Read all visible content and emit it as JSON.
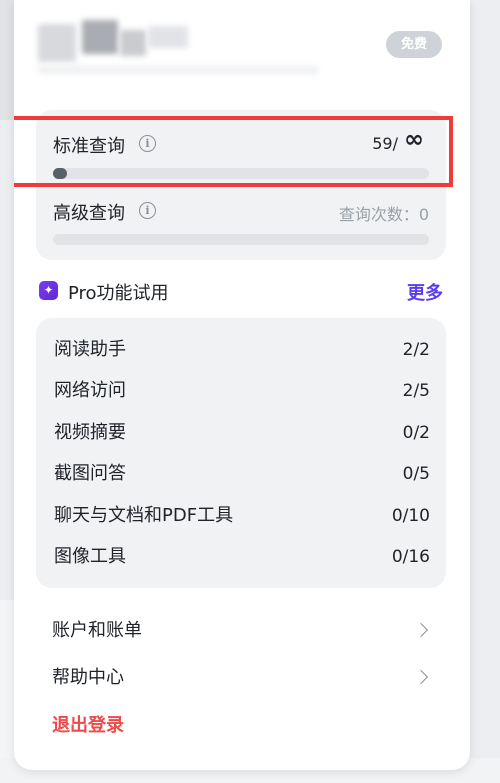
{
  "account": {
    "plan_badge": "免费"
  },
  "queries": {
    "standard": {
      "label": "标准查询",
      "count": "59/",
      "limit_symbol": "∞",
      "progress": 0.03
    },
    "advanced": {
      "label": "高级查询",
      "count_text": "查询次数：0",
      "progress": 0.0
    }
  },
  "pro": {
    "title": "Pro功能试用",
    "more_label": "更多",
    "accent_color": "#5b3bf0",
    "features": [
      {
        "label": "阅读助手",
        "value": "2/2"
      },
      {
        "label": "网络访问",
        "value": "2/5"
      },
      {
        "label": "视频摘要",
        "value": "0/2"
      },
      {
        "label": "截图问答",
        "value": "0/5"
      },
      {
        "label": "聊天与文档和PDF工具",
        "value": "0/10"
      },
      {
        "label": "图像工具",
        "value": "0/16"
      }
    ]
  },
  "menu": {
    "billing": "账户和账单",
    "help": "帮助中心",
    "logout": "退出登录"
  },
  "icons": {
    "info": "i",
    "pro": "✦"
  },
  "colors": {
    "highlight": "#ef3b3b",
    "logout": "#ef4a4a"
  }
}
